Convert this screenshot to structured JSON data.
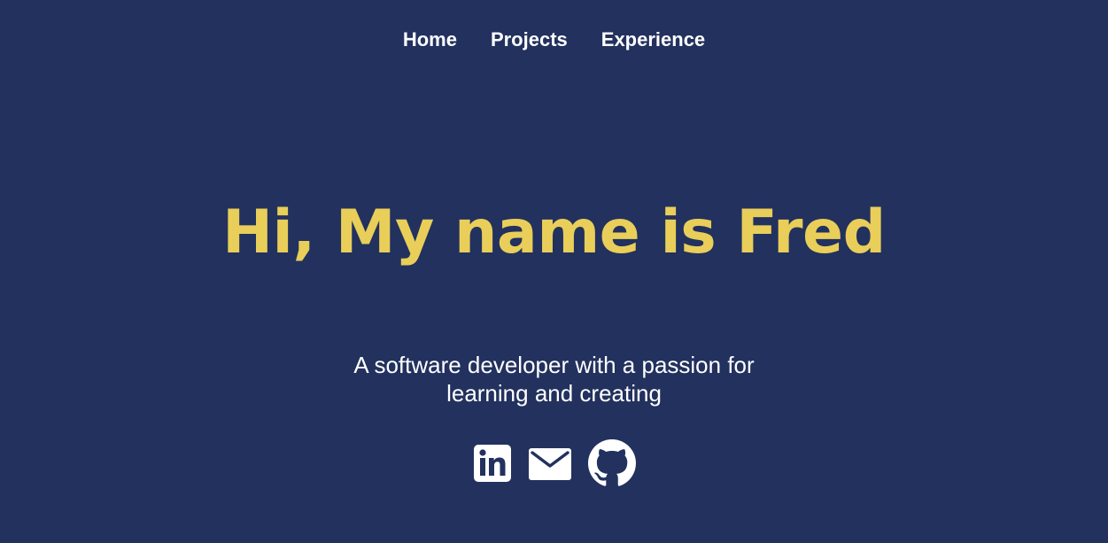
{
  "nav": {
    "items": [
      {
        "label": "Home"
      },
      {
        "label": "Projects"
      },
      {
        "label": "Experience"
      }
    ]
  },
  "hero": {
    "title": "Hi, My name is Fred",
    "tagline_line1": "A software developer with a passion for",
    "tagline_line2": "learning and creating"
  },
  "socials": [
    {
      "icon": "linkedin-icon"
    },
    {
      "icon": "email-icon"
    },
    {
      "icon": "github-icon"
    }
  ],
  "colors": {
    "background": "#22315e",
    "accent": "#e9ce59",
    "text": "#ffffff"
  }
}
